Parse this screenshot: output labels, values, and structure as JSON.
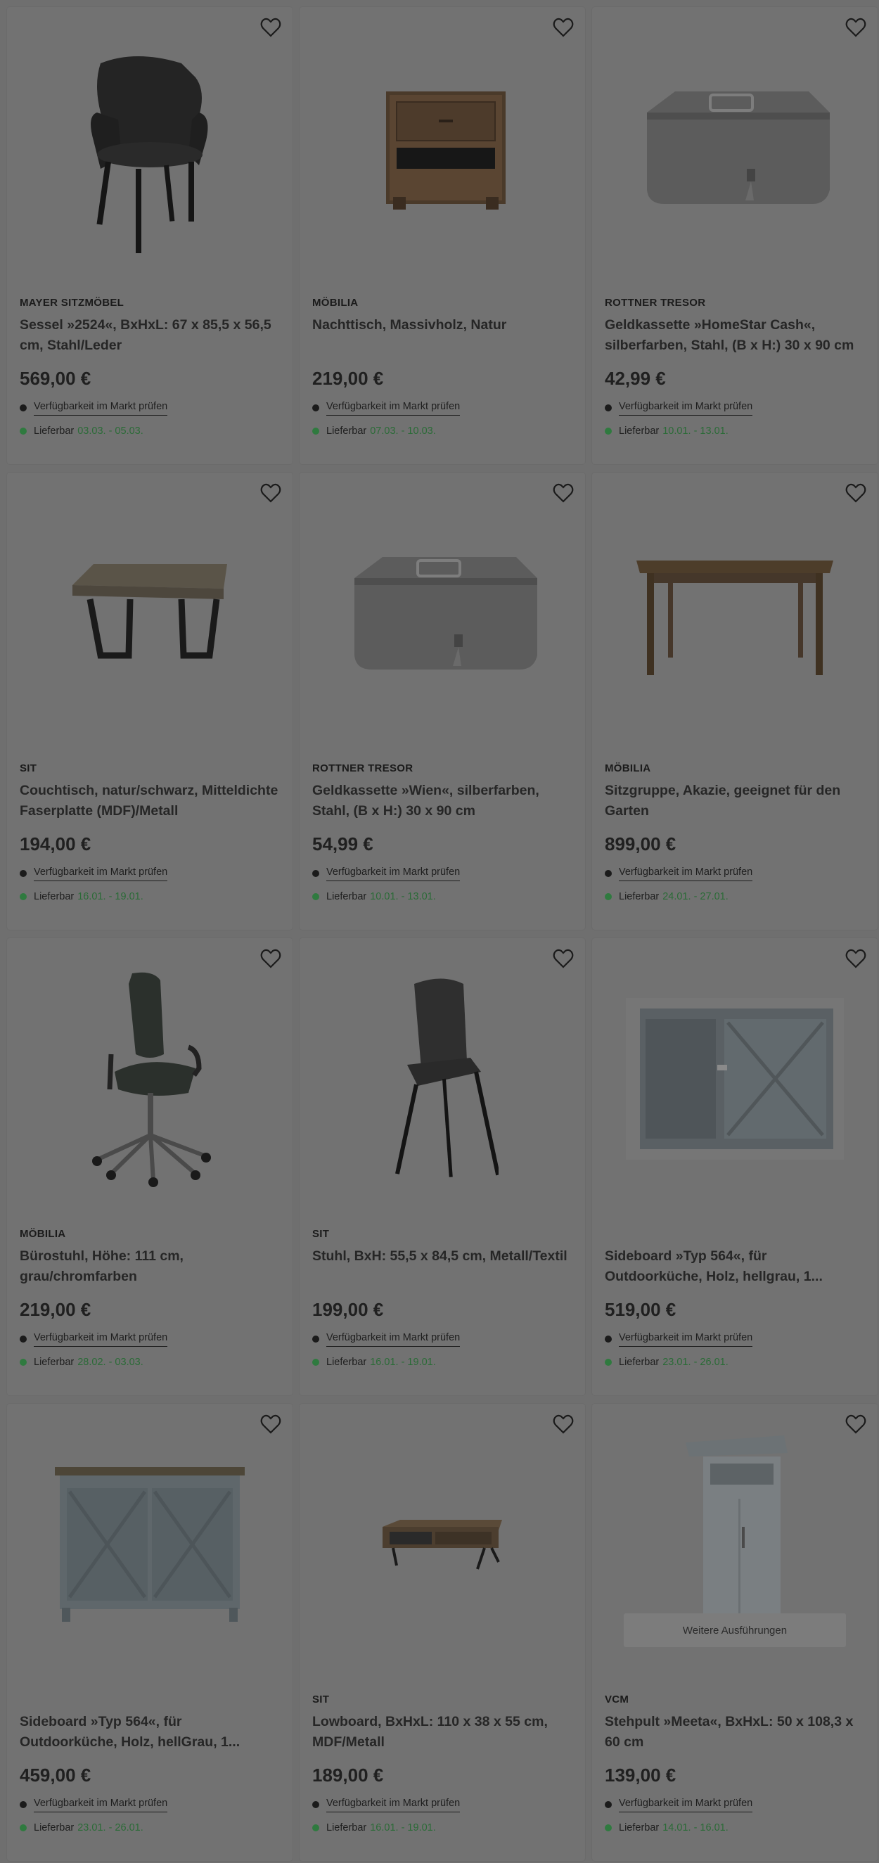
{
  "colors": {
    "overlay_bg": "#6f6f6f",
    "card_bg": "#727272",
    "delivery_dot": "#2f7a3f",
    "delivery_dates": "#2b6b37"
  },
  "labels": {
    "availability_link": "Verfügbarkeit im Markt prüfen",
    "delivery_prefix": "Lieferbar",
    "more_variants": "Weitere Ausführungen"
  },
  "icons": {
    "favorite": "heart-outline-icon"
  },
  "products": [
    {
      "brand": "MAYER SITZMÖBEL",
      "title": "Sessel »2524«, BxHxL: 67 x 85,5 x 56,5 cm, Stahl/Leder",
      "price": "569,00 €",
      "delivery": "03.03. - 05.03.",
      "image": "armchair"
    },
    {
      "brand": "MÖBILIA",
      "title": "Nachttisch, Massivholz, Natur",
      "price": "219,00 €",
      "delivery": "07.03. - 10.03.",
      "image": "nightstand"
    },
    {
      "brand": "ROTTNER TRESOR",
      "title": "Geldkassette »HomeStar Cash«, silberfarben, Stahl, (B x H:) 30 x 90 cm",
      "price": "42,99 €",
      "delivery": "10.01. - 13.01.",
      "image": "cashbox"
    },
    {
      "brand": "SIT",
      "title": "Couchtisch, natur/schwarz, Mitteldichte Faserplatte (MDF)/Metall",
      "price": "194,00 €",
      "delivery": "16.01. - 19.01.",
      "image": "coffee-table"
    },
    {
      "brand": "ROTTNER TRESOR",
      "title": "Geldkassette »Wien«, silberfarben, Stahl, (B x H:) 30 x 90 cm",
      "price": "54,99 €",
      "delivery": "10.01. - 13.01.",
      "image": "cashbox"
    },
    {
      "brand": "MÖBILIA",
      "title": "Sitzgruppe, Akazie, geeignet für den Garten",
      "price": "899,00 €",
      "delivery": "24.01. - 27.01.",
      "image": "wood-table"
    },
    {
      "brand": "MÖBILIA",
      "title": "Bürostuhl, Höhe: 111 cm, grau/chromfarben",
      "price": "219,00 €",
      "delivery": "28.02. - 03.03.",
      "image": "office-chair"
    },
    {
      "brand": "SIT",
      "title": "Stuhl, BxH: 55,5 x 84,5 cm, Metall/Textil",
      "price": "199,00 €",
      "delivery": "16.01. - 19.01.",
      "image": "dining-chair"
    },
    {
      "brand": "",
      "title": "Sideboard »Typ 564«, für Outdoorküche, Holz, hellgrau, 1...",
      "price": "519,00 €",
      "delivery": "23.01. - 26.01.",
      "image": "outdoor-sideboard"
    },
    {
      "brand": "",
      "title": "Sideboard »Typ 564«, für Outdoorküche, Holz, hellGrau, 1...",
      "price": "459,00 €",
      "delivery": "23.01. - 26.01.",
      "image": "sideboard"
    },
    {
      "brand": "SIT",
      "title": "Lowboard, BxHxL: 110 x 38 x 55 cm, MDF/Metall",
      "price": "189,00 €",
      "delivery": "16.01. - 19.01.",
      "image": "lowboard"
    },
    {
      "brand": "VCM",
      "title": "Stehpult »Meeta«, BxHxL: 50 x 108,3 x 60 cm",
      "price": "139,00 €",
      "delivery": "14.01. - 16.01.",
      "image": "lectern",
      "has_more_variants": true
    }
  ]
}
